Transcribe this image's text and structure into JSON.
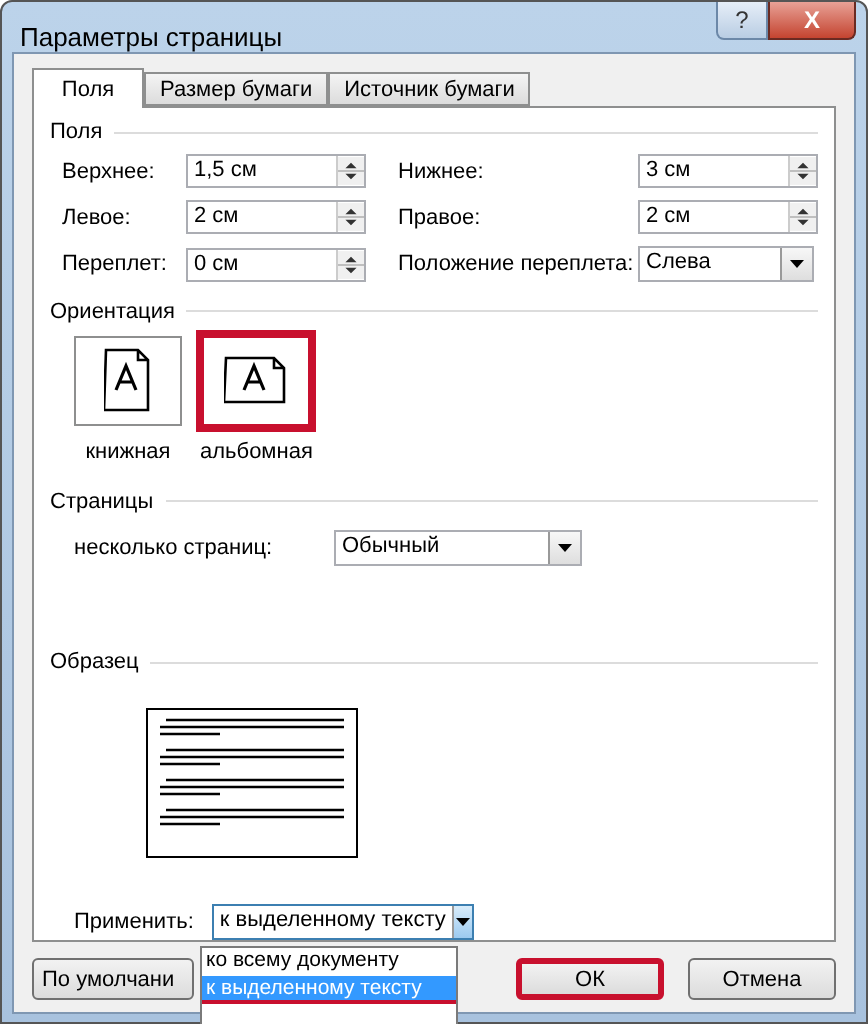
{
  "window": {
    "title": "Параметры страницы",
    "help_button": "?",
    "close_button": "X"
  },
  "tabs": [
    {
      "label": "Поля",
      "selected": true
    },
    {
      "label": "Размер бумаги",
      "selected": false
    },
    {
      "label": "Источник бумаги",
      "selected": false
    }
  ],
  "margins": {
    "heading": "Поля",
    "fields": [
      {
        "label": "Верхнее:",
        "value": "1,5 см",
        "kind": "spin"
      },
      {
        "label": "Нижнее:",
        "value": "3 см",
        "kind": "spin"
      },
      {
        "label": "Левое:",
        "value": "2 см",
        "kind": "spin"
      },
      {
        "label": "Правое:",
        "value": "2 см",
        "kind": "spin"
      },
      {
        "label": "Переплет:",
        "value": "0 см",
        "kind": "spin"
      },
      {
        "label": "Положение переплета:",
        "value": "Слева",
        "kind": "combo"
      }
    ]
  },
  "orientation": {
    "heading": "Ориентация",
    "options": [
      {
        "label": "книжная",
        "kind": "portrait",
        "highlighted": false
      },
      {
        "label": "альбомная",
        "kind": "landscape",
        "highlighted": true
      }
    ]
  },
  "pages": {
    "heading": "Страницы",
    "label": "несколько страниц:",
    "value": "Обычный"
  },
  "sample": {
    "heading": "Образец"
  },
  "apply": {
    "label": "Применить:",
    "value": "к выделенному тексту",
    "expanded": true,
    "options": [
      {
        "label": "ко всему документу",
        "selected": false,
        "underlined": false
      },
      {
        "label": "к выделенному тексту",
        "selected": true,
        "underlined": true
      }
    ]
  },
  "buttons": [
    {
      "label": "По умолчани",
      "kind": "default",
      "highlighted": false
    },
    {
      "label": "ОК",
      "kind": "ok",
      "highlighted": true
    },
    {
      "label": "Отмена",
      "kind": "cancel",
      "highlighted": false
    }
  ]
}
